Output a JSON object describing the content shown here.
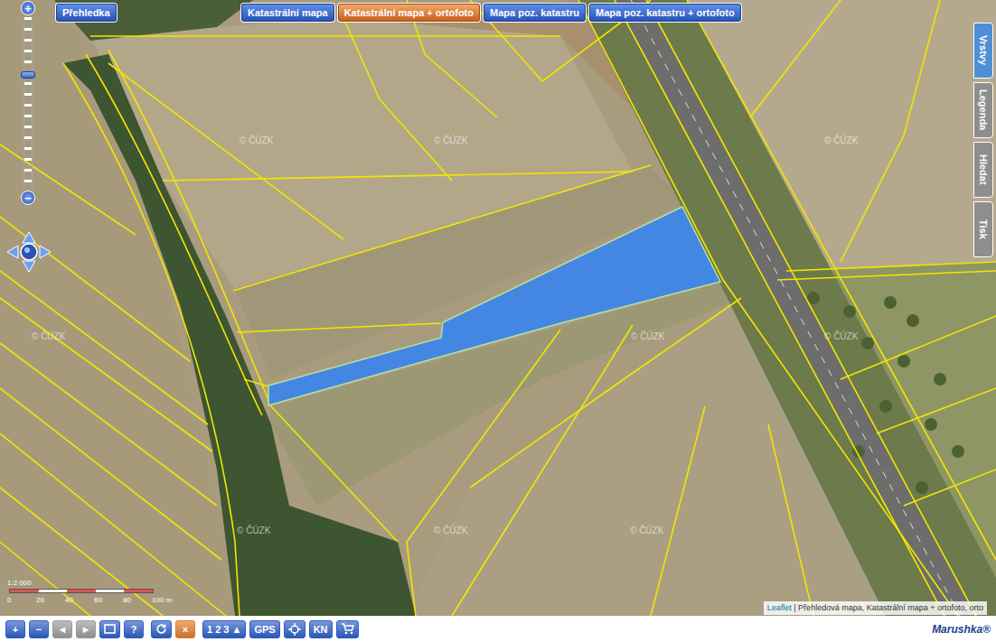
{
  "overview_button": {
    "label": "Přehledka"
  },
  "layer_buttons": [
    {
      "label": "Katastrální mapa",
      "selected": false
    },
    {
      "label": "Katastrální mapa + ortofoto",
      "selected": true
    },
    {
      "label": "Mapa poz. katastru",
      "selected": false
    },
    {
      "label": "Mapa poz. katastru + ortofoto",
      "selected": false
    }
  ],
  "side_tabs": [
    {
      "label": "Vrstvy",
      "selected": true
    },
    {
      "label": "Legenda",
      "selected": false
    },
    {
      "label": "Hledat",
      "selected": false
    },
    {
      "label": "Tisk",
      "selected": false
    }
  ],
  "zoom": {
    "in_label": "+",
    "out_label": "−",
    "level": 0.67
  },
  "selected_parcel": {
    "selected": true
  },
  "watermarks": [
    "© ČÚZK",
    "© ČÚZK",
    "© ČÚZK",
    "© ČÚZK",
    "© ČÚZK",
    "© ČÚZK",
    "© ČÚZK",
    "© ČÚZK",
    "© ČÚZK"
  ],
  "scale": {
    "ratio": "1:2 000",
    "ticks": [
      "0",
      "20",
      "40",
      "60",
      "80",
      "100 m"
    ]
  },
  "attribution": {
    "link": "Leaflet",
    "text": "| Přehledová mapa, Katastrální mapa + ortofoto, orto"
  },
  "toolbar": {
    "groups": [
      [
        {
          "kind": "text",
          "label": "+",
          "color": "#2f5fc4"
        },
        {
          "kind": "text",
          "label": "−",
          "color": "#2f5fc4"
        },
        {
          "kind": "text",
          "label": "◄",
          "color": "#9a9a9a"
        },
        {
          "kind": "text",
          "label": "►",
          "color": "#9a9a9a"
        },
        {
          "kind": "icon",
          "color": "#2f5fc4"
        },
        {
          "kind": "text",
          "label": "?",
          "color": "#2f5fc4"
        }
      ],
      [
        {
          "kind": "icon",
          "color": "#2f5fc4"
        },
        {
          "kind": "text",
          "label": "×",
          "color": "#e07b2a"
        }
      ],
      [
        {
          "kind": "text",
          "label": "1 2 3 ▲",
          "color": "#2f5fc4"
        },
        {
          "kind": "text",
          "label": "GPS",
          "color": "#2f5fc4"
        },
        {
          "kind": "icon",
          "color": "#2f5fc4"
        },
        {
          "kind": "text",
          "label": "KN",
          "color": "#2f5fc4"
        },
        {
          "kind": "icon",
          "color": "#2f5fc4"
        }
      ]
    ]
  },
  "logo": "Marushka®"
}
